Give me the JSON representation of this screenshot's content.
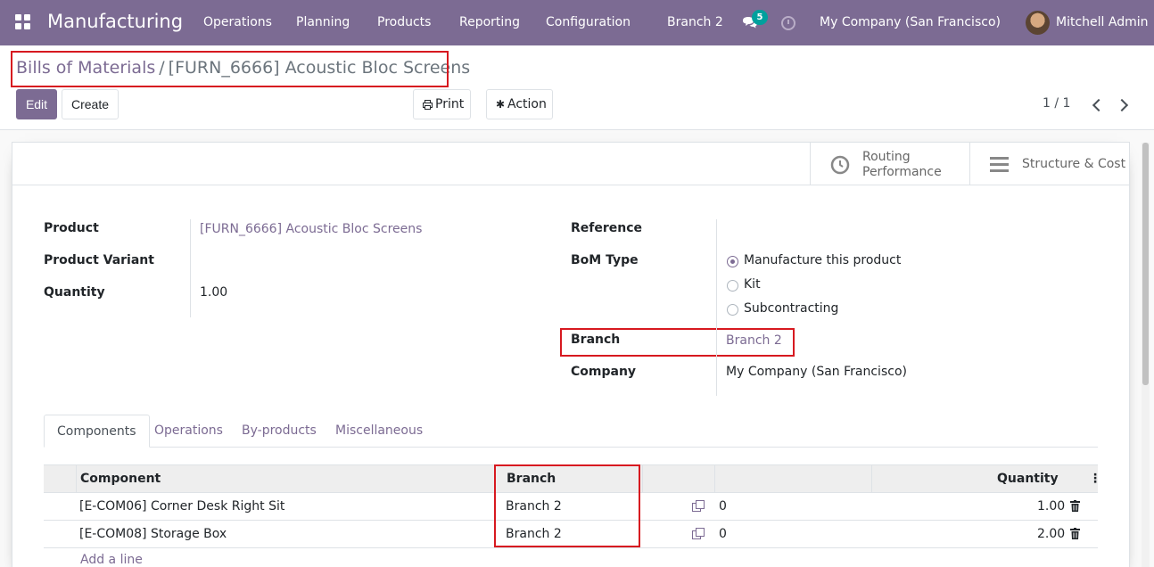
{
  "navbar": {
    "app_name": "Manufacturing",
    "menu": [
      "Operations",
      "Planning",
      "Products",
      "Reporting",
      "Configuration"
    ],
    "branch": "Branch 2",
    "message_count": "5",
    "company": "My Company (San Francisco)",
    "user": "Mitchell Admin"
  },
  "breadcrumb": {
    "parent": "Bills of Materials",
    "separator": "/",
    "current": "[FURN_6666] Acoustic Bloc Screens"
  },
  "toolbar": {
    "edit_label": "Edit",
    "create_label": "Create",
    "print_label": "Print",
    "action_label": "Action"
  },
  "pager": {
    "value": "1 / 1"
  },
  "smart_buttons": {
    "routing_line1": "Routing",
    "routing_line2": "Performance",
    "structure_label": "Structure & Cost"
  },
  "form": {
    "product_label": "Product",
    "product_value": "[FURN_6666] Acoustic Bloc Screens",
    "variant_label": "Product Variant",
    "variant_value": "",
    "quantity_label": "Quantity",
    "quantity_value": "1.00",
    "reference_label": "Reference",
    "reference_value": "",
    "bom_type_label": "BoM Type",
    "bom_type_options": [
      "Manufacture this product",
      "Kit",
      "Subcontracting"
    ],
    "bom_type_selected": "Manufacture this product",
    "branch_label": "Branch",
    "branch_value": "Branch 2",
    "company_label": "Company",
    "company_value": "My Company (San Francisco)"
  },
  "tabs": [
    "Components",
    "Operations",
    "By-products",
    "Miscellaneous"
  ],
  "active_tab": "Components",
  "components": {
    "columns": {
      "component": "Component",
      "branch": "Branch",
      "quantity": "Quantity"
    },
    "rows": [
      {
        "component": "[E-COM06] Corner Desk Right Sit",
        "branch": "Branch 2",
        "extra": "0",
        "quantity": "1.00"
      },
      {
        "component": "[E-COM08] Storage Box",
        "branch": "Branch 2",
        "extra": "0",
        "quantity": "2.00"
      }
    ],
    "add_line": "Add a line"
  },
  "colors": {
    "brand": "#7c6b93",
    "highlight": "#d71920",
    "badge": "#00a09d"
  }
}
